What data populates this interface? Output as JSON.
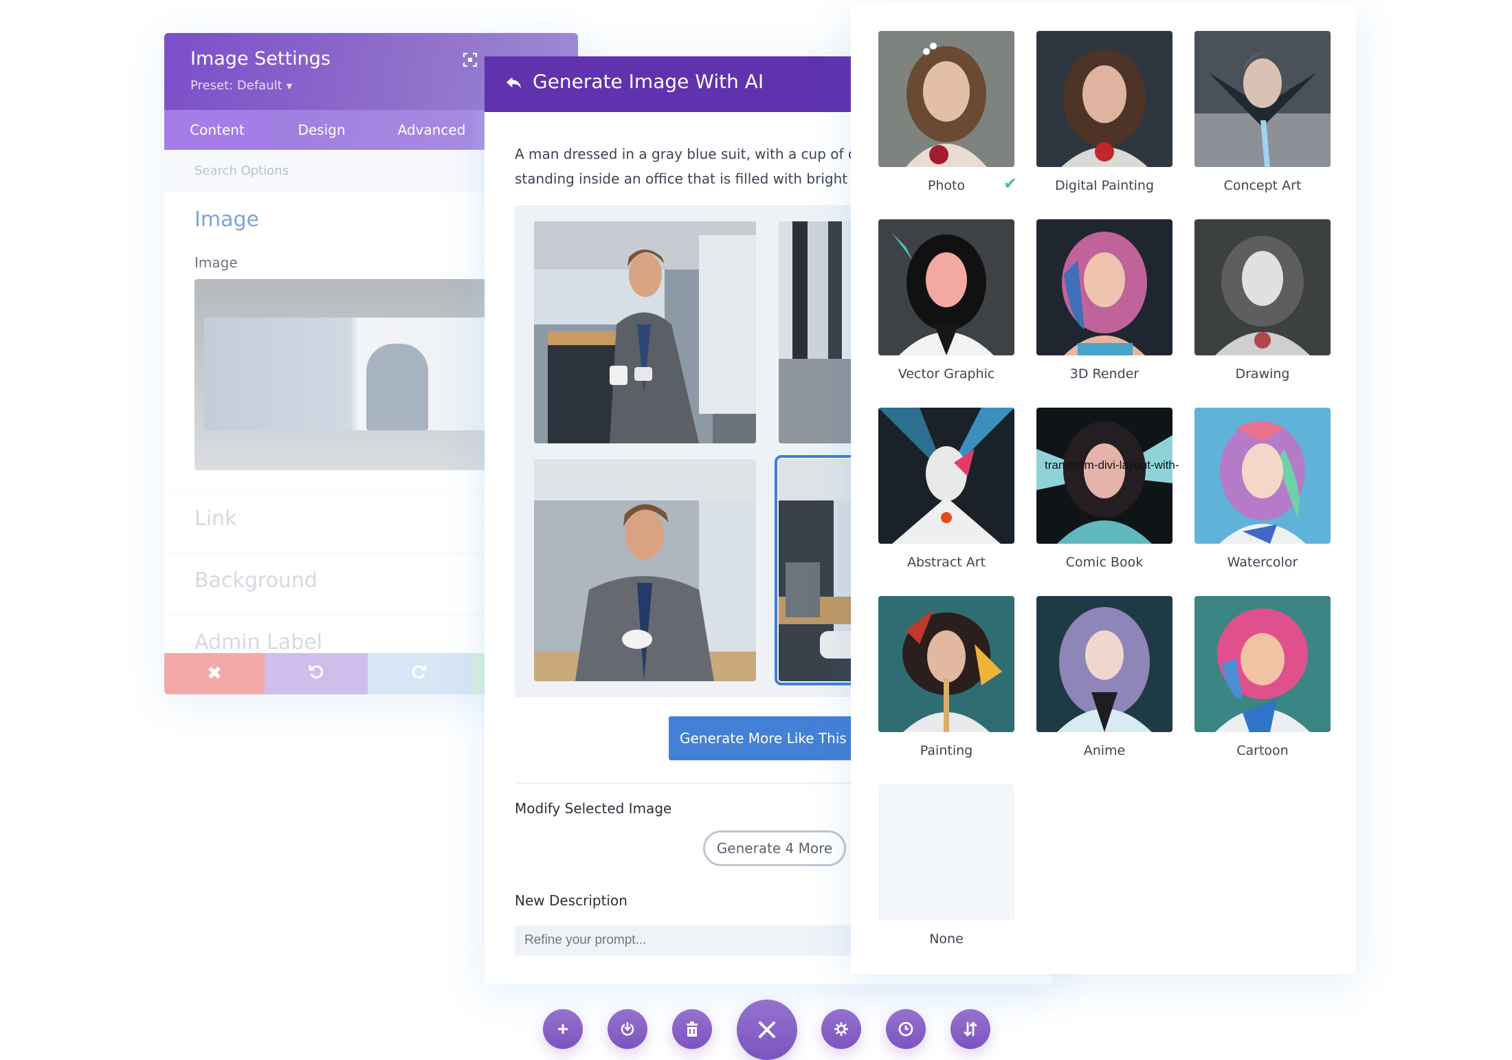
{
  "settings_panel": {
    "title": "Image Settings",
    "preset": "Preset: Default",
    "tabs": [
      {
        "label": "Content",
        "active": true
      },
      {
        "label": "Design",
        "active": false
      },
      {
        "label": "Advanced",
        "active": false
      }
    ],
    "search_placeholder": "Search Options",
    "section_title": "Image",
    "image_field_label": "Image",
    "toggles": [
      "Link",
      "Background",
      "Admin Label"
    ],
    "bottom_bar": {
      "discard_color": "#f1aaa7",
      "undo_color": "#cfbdec",
      "redo_color": "#d4e3f5"
    }
  },
  "ai_panel": {
    "title": "Generate Image With AI",
    "prompt_line1": "A man dressed in a gray blue suit, with a cup of co",
    "prompt_line2": "standing inside an office that is filled with bright l",
    "generate_more_like_label": "Generate More Like This (",
    "modify_label": "Modify Selected Image",
    "generate_4_label": "Generate 4 More",
    "new_description_label": "New Description",
    "refine_placeholder": "Refine your prompt...",
    "accent_color": "#6032ae",
    "button_color": "#4480d6",
    "selected_image_index": 3
  },
  "style_panel": {
    "styles": [
      {
        "label": "Photo",
        "selected": true
      },
      {
        "label": "Digital Painting",
        "selected": false
      },
      {
        "label": "Concept Art",
        "selected": false
      },
      {
        "label": "Vector Graphic",
        "selected": false
      },
      {
        "label": "3D Render",
        "selected": false
      },
      {
        "label": "Drawing",
        "selected": false
      },
      {
        "label": "Abstract Art",
        "selected": false
      },
      {
        "label": "Comic Book",
        "selected": false
      },
      {
        "label": "Watercolor",
        "selected": false
      },
      {
        "label": "Painting",
        "selected": false
      },
      {
        "label": "Anime",
        "selected": false
      },
      {
        "label": "Cartoon",
        "selected": false
      },
      {
        "label": "None",
        "selected": false
      }
    ],
    "overlay_alt_text": "transform-divi-layout-with-",
    "check_color": "#3fbf9b"
  },
  "toolbar": {
    "buttons": [
      {
        "icon": "plus-icon"
      },
      {
        "icon": "power-icon"
      },
      {
        "icon": "trash-icon"
      },
      {
        "icon": "close-icon"
      },
      {
        "icon": "gear-icon"
      },
      {
        "icon": "history-icon"
      },
      {
        "icon": "sort-icon"
      }
    ],
    "color": "#8a63cc"
  }
}
